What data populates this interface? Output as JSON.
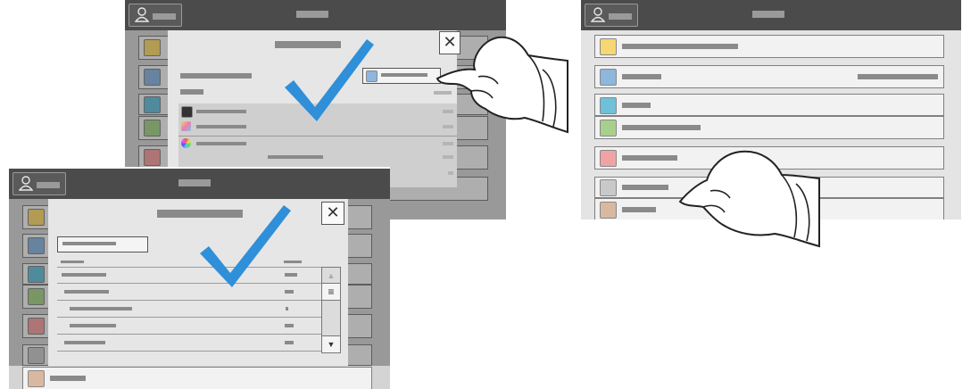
{
  "icons": {
    "user": "user-icon",
    "close": "close-icon",
    "check": "checkmark-icon",
    "hand": "pointing-hand-icon",
    "globe": "globe-icon",
    "scroll_up": "scroll-up-icon",
    "scroll_down": "scroll-down-icon",
    "scroll_handle": "scroll-handle-icon"
  },
  "glyphs": {
    "close": "✕",
    "scroll_up": "▲",
    "scroll_down": "▼",
    "scroll_handle": "≡"
  },
  "colors": {
    "topbar": "#4b4b4b",
    "check": "#2f8fd8",
    "app_yellow": "#f7d774",
    "app_blue": "#8fb6dd",
    "app_teal": "#6ec1d9",
    "app_green": "#a8d08d",
    "app_red": "#f0a3a3",
    "app_grey": "#c9c9c9",
    "app_tan": "#d9b8a0"
  }
}
